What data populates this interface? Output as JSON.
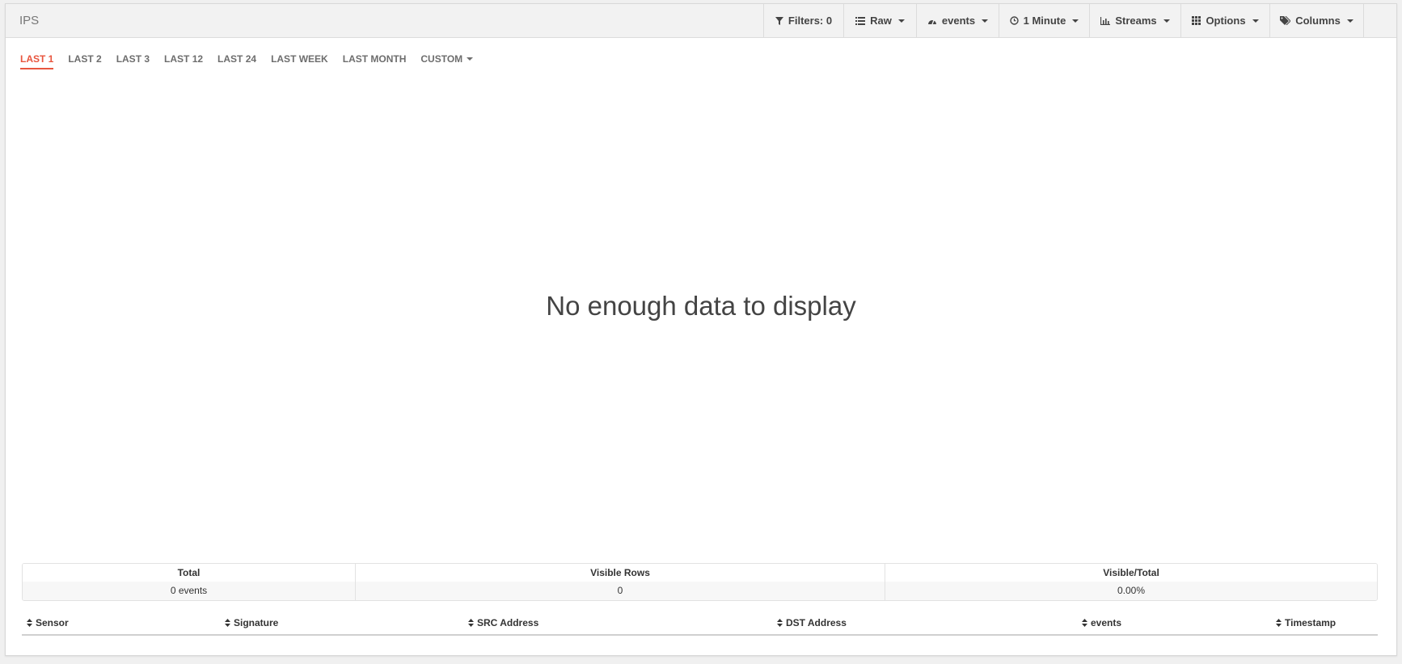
{
  "panel": {
    "title": "IPS"
  },
  "toolbar": {
    "filters": {
      "label": "Filters: 0",
      "icon": "filter-icon"
    },
    "raw": {
      "label": "Raw",
      "icon": "list-icon"
    },
    "events": {
      "label": "events",
      "icon": "dashboard-icon"
    },
    "interval": {
      "label": "1 Minute",
      "icon": "clock-icon"
    },
    "streams": {
      "label": "Streams",
      "icon": "bar-chart-icon"
    },
    "options": {
      "label": "Options",
      "icon": "grid-icon"
    },
    "columns": {
      "label": "Columns",
      "icon": "tags-icon"
    }
  },
  "time_tabs": [
    {
      "label": "LAST 1",
      "active": true
    },
    {
      "label": "LAST 2",
      "active": false
    },
    {
      "label": "LAST 3",
      "active": false
    },
    {
      "label": "LAST 12",
      "active": false
    },
    {
      "label": "LAST 24",
      "active": false
    },
    {
      "label": "LAST WEEK",
      "active": false
    },
    {
      "label": "LAST MONTH",
      "active": false
    },
    {
      "label": "CUSTOM",
      "active": false
    }
  ],
  "chart": {
    "empty_message": "No enough data to display"
  },
  "stats": {
    "total": {
      "label": "Total",
      "value": "0 events"
    },
    "visible_rows": {
      "label": "Visible Rows",
      "value": "0"
    },
    "visible_total": {
      "label": "Visible/Total",
      "value": "0.00%"
    }
  },
  "table": {
    "columns": [
      "Sensor",
      "Signature",
      "SRC Address",
      "DST Address",
      "events",
      "Timestamp"
    ]
  },
  "colors": {
    "accent": "#e8553e",
    "header_bg": "#f2f2f2",
    "text": "#333333"
  }
}
